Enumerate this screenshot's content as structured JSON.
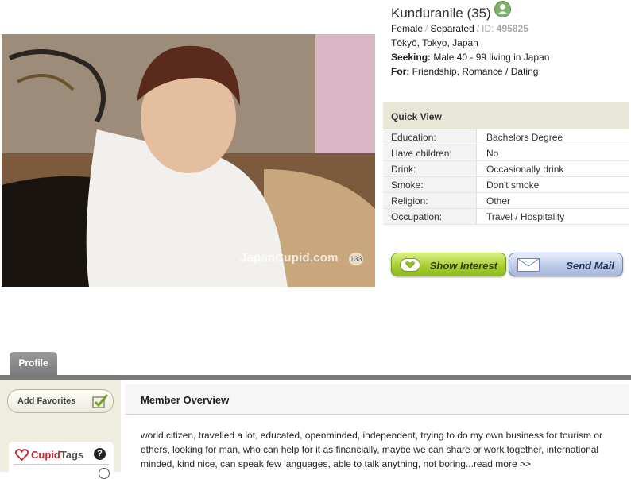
{
  "profile": {
    "name": "Kunduranile",
    "age": "(35)",
    "gender": "Female",
    "status": "Separated",
    "id_label": "ID:",
    "id_value": "495825",
    "location": "Tōkyō, Tokyo, Japan",
    "seeking_label": "Seeking:",
    "seeking_value": "Male 40 - 99 living in Japan",
    "for_label": "For:",
    "for_value": "Friendship, Romance / Dating"
  },
  "photo": {
    "watermark": "JapanCupid.com",
    "watermark_number": "133"
  },
  "quick_view": {
    "title": "Quick View",
    "rows": [
      {
        "key": "Education:",
        "value": "Bachelors Degree"
      },
      {
        "key": "Have children:",
        "value": "No"
      },
      {
        "key": "Drink:",
        "value": "Occasionally drink"
      },
      {
        "key": "Smoke:",
        "value": "Don't smoke"
      },
      {
        "key": "Religion:",
        "value": "Other"
      },
      {
        "key": "Occupation:",
        "value": "Travel / Hospitality"
      }
    ]
  },
  "actions": {
    "show_interest": "Show Interest",
    "send_mail": "Send Mail"
  },
  "tabs": {
    "profile": "Profile"
  },
  "sidebar": {
    "add_favorites": "Add Favorites",
    "cupid_tags_a": "Cupid",
    "cupid_tags_b": "Tags",
    "help": "?"
  },
  "overview": {
    "title": "Member Overview",
    "text": "world citizen, travelled a lot, educated, openminded, independent, trying to do my own business for tourism or others, looking for man, who can help for it as financially, maybe we can share or work together, international minded, kind nice, can speak few languages, able to talk anything, not boring...",
    "read_more": "read more >>"
  },
  "colors": {
    "interest_green": "#a9cf34",
    "mail_blue": "#bcc9e6",
    "tab_gray": "#7a7a7a",
    "quickview_header": "#e8e6d6",
    "cupid_red": "#c0282d"
  }
}
